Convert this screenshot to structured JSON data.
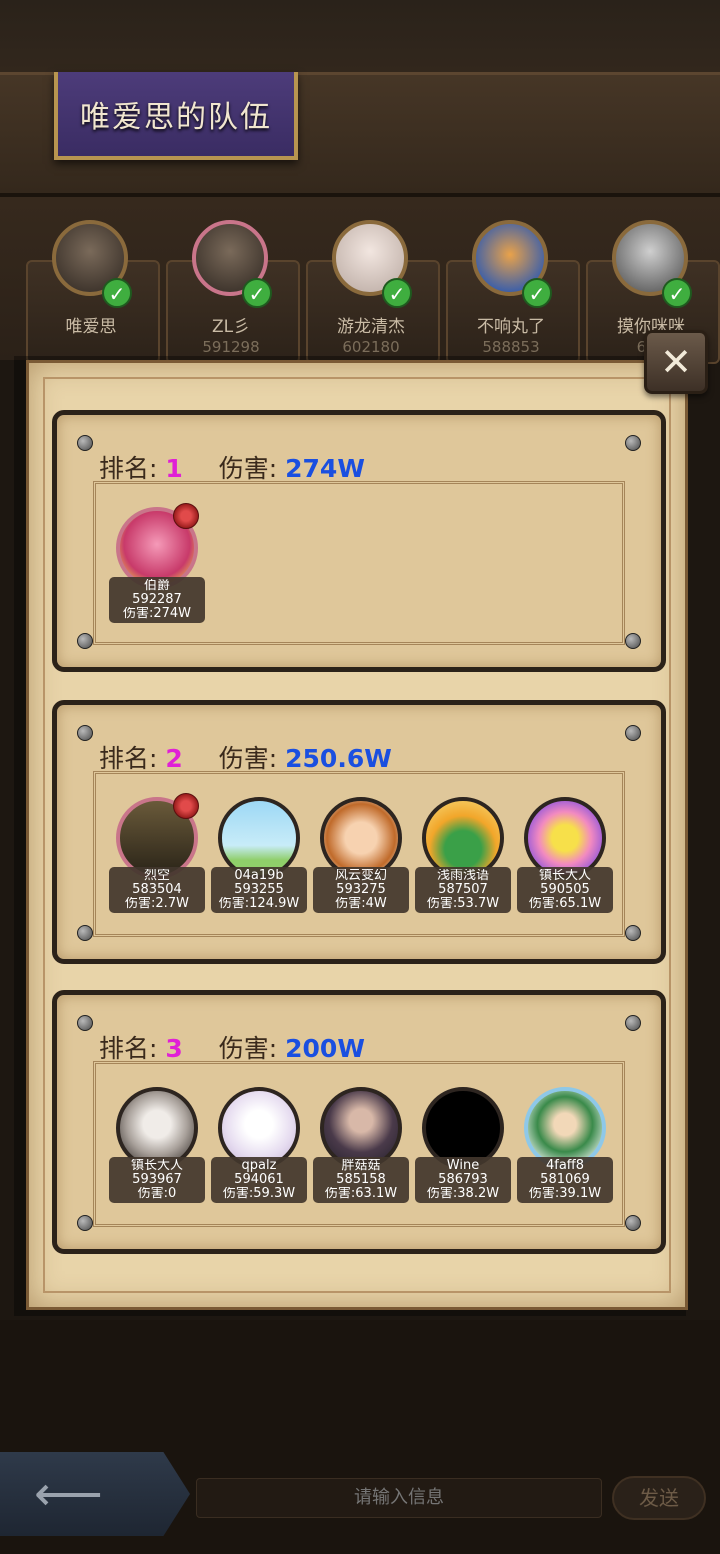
{
  "team": {
    "title": "唯爱思的队伍"
  },
  "members": [
    {
      "name": "唯爱思",
      "id": ""
    },
    {
      "name": "ZL彡",
      "id": "591298"
    },
    {
      "name": "游龙清杰",
      "id": "602180"
    },
    {
      "name": "不响丸了",
      "id": "588853"
    },
    {
      "name": "摸你咪咪",
      "id": "603"
    }
  ],
  "labels": {
    "rank": "排名:",
    "damage": "伤害:"
  },
  "ranks": [
    {
      "rank": "1",
      "damage": "274W",
      "players": [
        {
          "name": "伯爵",
          "id": "592287",
          "damage": "伤害:274W",
          "avatar_color": "#e86a9a"
        }
      ]
    },
    {
      "rank": "2",
      "damage": "250.6W",
      "players": [
        {
          "name": "烈空",
          "id": "583504",
          "damage": "伤害:2.7W",
          "avatar_color": "#5a4a30"
        },
        {
          "name": "04a19b",
          "id": "593255",
          "damage": "伤害:124.9W",
          "avatar_color": "#8fd0f0"
        },
        {
          "name": "风云变幻",
          "id": "593275",
          "damage": "伤害:4W",
          "avatar_color": "#e8b07a"
        },
        {
          "name": "浅雨浅语",
          "id": "587507",
          "damage": "伤害:53.7W",
          "avatar_color": "#f0a030"
        },
        {
          "name": "镇长大人",
          "id": "590505",
          "damage": "伤害:65.1W",
          "avatar_color": "#8a5ae0"
        }
      ]
    },
    {
      "rank": "3",
      "damage": "200W",
      "players": [
        {
          "name": "镇长大人",
          "id": "593967",
          "damage": "伤害:0",
          "avatar_color": "#b0a8a0"
        },
        {
          "name": "qpalz",
          "id": "594061",
          "damage": "伤害:59.3W",
          "avatar_color": "#e8e0f0"
        },
        {
          "name": "胖菇菇",
          "id": "585158",
          "damage": "伤害:63.1W",
          "avatar_color": "#6a5a70"
        },
        {
          "name": "Wine",
          "id": "586793",
          "damage": "伤害:38.2W",
          "avatar_color": "#000000"
        },
        {
          "name": "4faff8",
          "id": "581069",
          "damage": "伤害:39.1W",
          "avatar_color": "#7ab87a"
        }
      ]
    }
  ],
  "chat": {
    "placeholder": "请输入信息",
    "send_label": "发送"
  },
  "icons": {
    "close": "crossed-swords-icon",
    "back": "left-arrow-icon",
    "check": "check-icon"
  }
}
